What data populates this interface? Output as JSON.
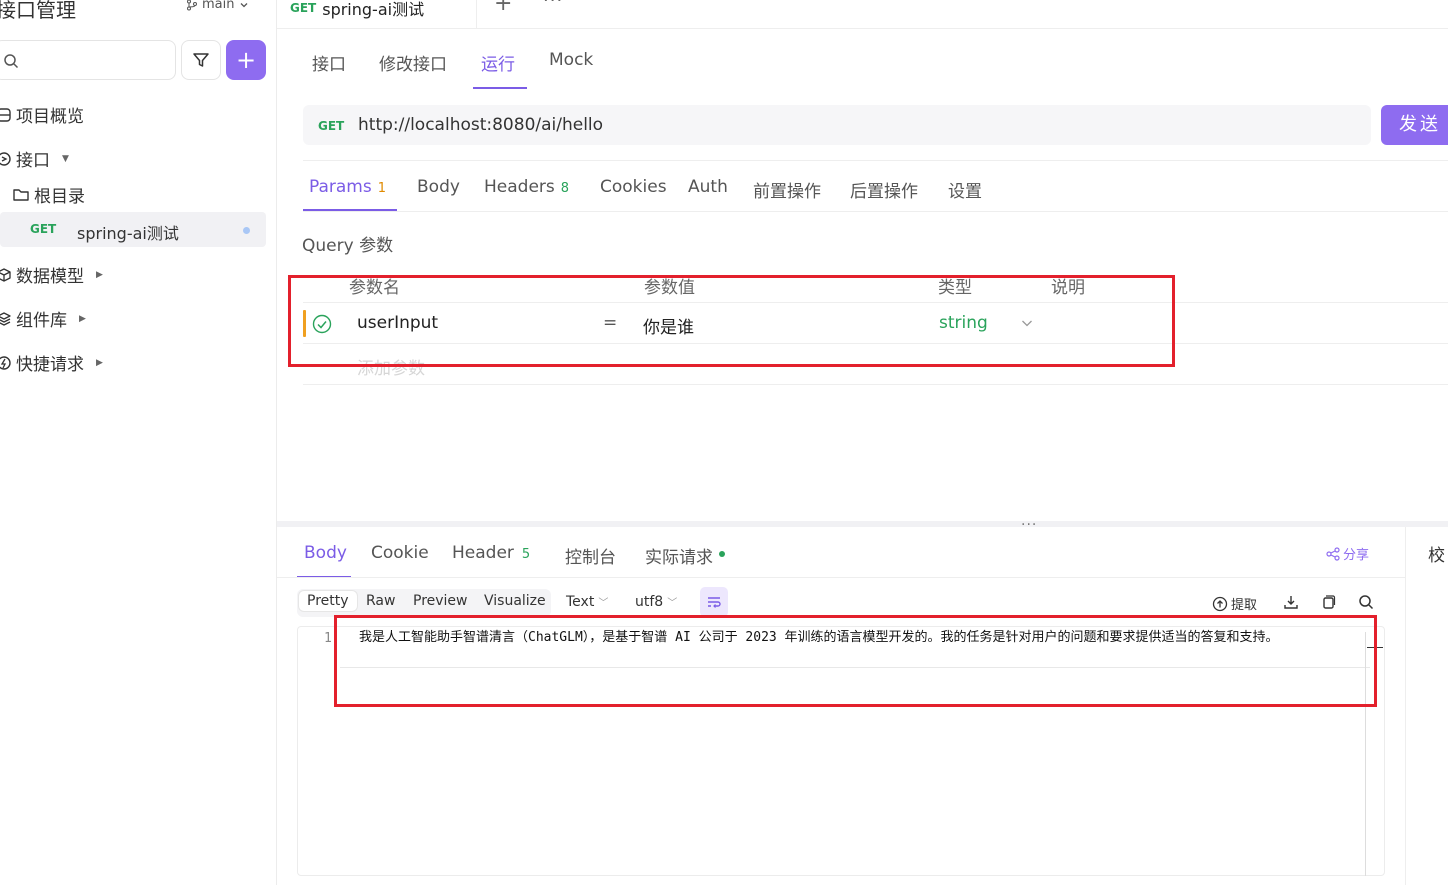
{
  "sidebar": {
    "title": "接口管理",
    "branch": "main",
    "nav": {
      "overview": "项目概览",
      "interfaces": "接口",
      "root": "根目录",
      "models": "数据模型",
      "components": "组件库",
      "quick": "快捷请求"
    },
    "api_item": {
      "method": "GET",
      "name": "spring-ai测试"
    }
  },
  "doc_tab": {
    "method": "GET",
    "name": "spring-ai测试"
  },
  "subtabs": [
    "接口",
    "修改接口",
    "运行",
    "Mock"
  ],
  "request": {
    "method": "GET",
    "url": "http://localhost:8080/ai/hello",
    "send_label": "发送"
  },
  "request_tabs": {
    "params": "Params",
    "params_count": "1",
    "body": "Body",
    "headers": "Headers",
    "headers_count": "8",
    "cookies": "Cookies",
    "auth": "Auth",
    "pre": "前置操作",
    "post": "后置操作",
    "settings": "设置"
  },
  "query": {
    "title": "Query 参数",
    "columns": {
      "name": "参数名",
      "value": "参数值",
      "type": "类型",
      "desc": "说明"
    },
    "row": {
      "name": "userInput",
      "eq": "=",
      "value": "你是谁",
      "type": "string"
    },
    "add_placeholder": "添加参数"
  },
  "response_tabs": {
    "body": "Body",
    "cookie": "Cookie",
    "header": "Header",
    "header_count": "5",
    "console": "控制台",
    "actual": "实际请求",
    "share": "分享",
    "right_label": "校"
  },
  "format": {
    "pretty": "Pretty",
    "raw": "Raw",
    "preview": "Preview",
    "visualize": "Visualize",
    "text": "Text",
    "encoding": "utf8",
    "extract": "提取"
  },
  "response_body": {
    "line_number": "1",
    "text": "我是人工智能助手智谱清言（ChatGLM），是基于智谱 AI 公司于 2023 年训练的语言模型开发的。我的任务是针对用户的问题和要求提供适当的答复和支持。"
  },
  "colors": {
    "accent": "#8e6cf0",
    "get": "#2aa35b",
    "highlight": "#e3202c"
  }
}
